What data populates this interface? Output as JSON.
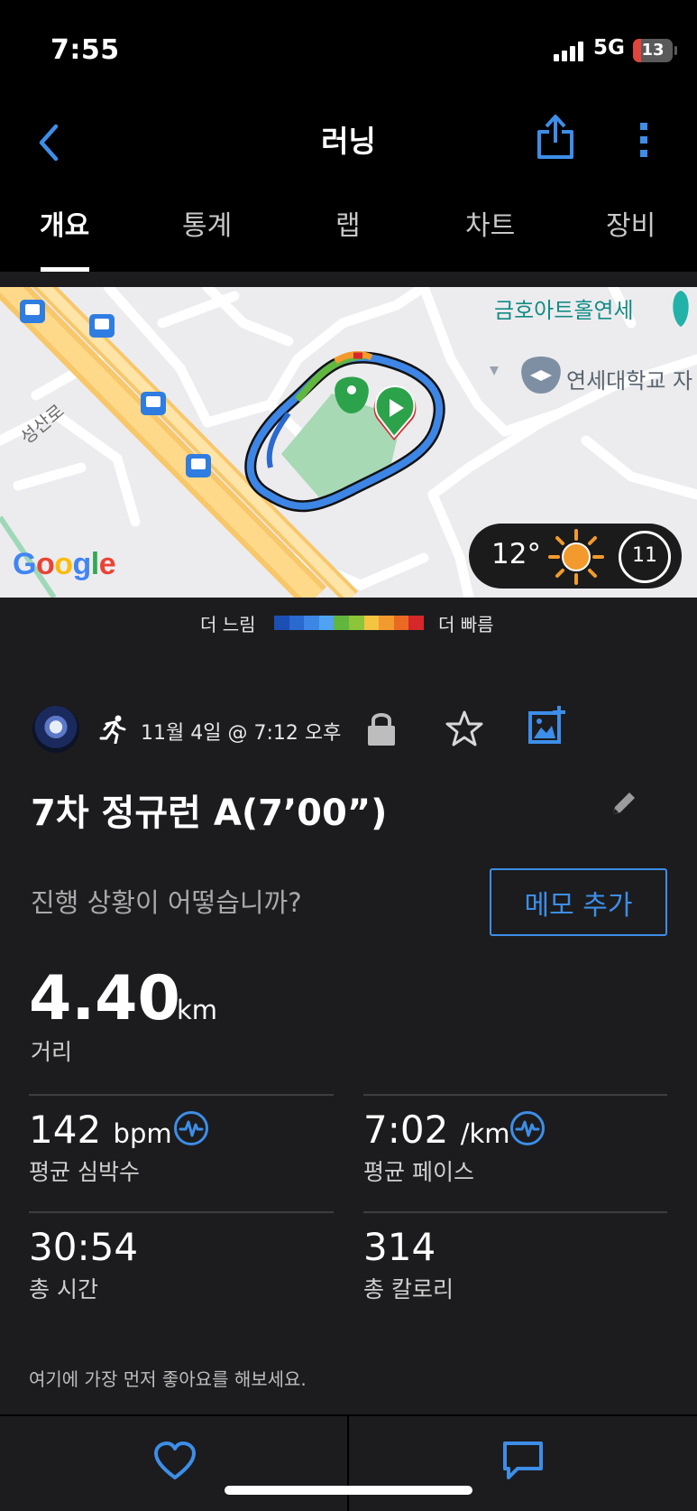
{
  "status_bar": {
    "time": "7:55",
    "network": "5G",
    "battery": "13"
  },
  "nav": {
    "title": "러닝",
    "back_icon": "chevron-left-icon",
    "share_icon": "share-icon",
    "more_icon": "more-vertical-icon"
  },
  "tabs": [
    {
      "label": "개요",
      "active": true
    },
    {
      "label": "통계",
      "active": false
    },
    {
      "label": "랩",
      "active": false
    },
    {
      "label": "차트",
      "active": false
    },
    {
      "label": "장비",
      "active": false
    }
  ],
  "map": {
    "labels": {
      "art_hall": "금호아트홀연세",
      "university": "연세대학교 자",
      "road": "성산로",
      "google": "Google"
    },
    "weather": {
      "temperature": "12°",
      "wind": "11"
    }
  },
  "pace_legend": {
    "slow_label": "더 느림",
    "fast_label": "더 빠름",
    "colors": [
      "#1b4fb3",
      "#2a69cf",
      "#3d86e6",
      "#4fa3f2",
      "#61b63e",
      "#8cc43a",
      "#f5c542",
      "#f29a2e",
      "#ea6a23",
      "#d6272b"
    ]
  },
  "activity": {
    "date": "11월 4일 @ 7:12 오후",
    "title": "7차 정규런 A(7’00”)",
    "prompt": "진행 상황이 어떻습니까?",
    "memo_button": "메모 추가"
  },
  "stats": {
    "distance": {
      "value": "4.40",
      "unit": "km",
      "label": "거리"
    },
    "heart_rate": {
      "value": "142",
      "unit": "bpm",
      "label": "평균 심박수"
    },
    "pace": {
      "value": "7:02",
      "unit": "/km",
      "label": "평균 페이스"
    },
    "time": {
      "value": "30:54",
      "label": "총 시간"
    },
    "calories": {
      "value": "314",
      "label": "총 칼로리"
    }
  },
  "like_prompt": "여기에 가장 먼저 좋아요를 해보세요.",
  "accent_color": "#3d8ee8"
}
